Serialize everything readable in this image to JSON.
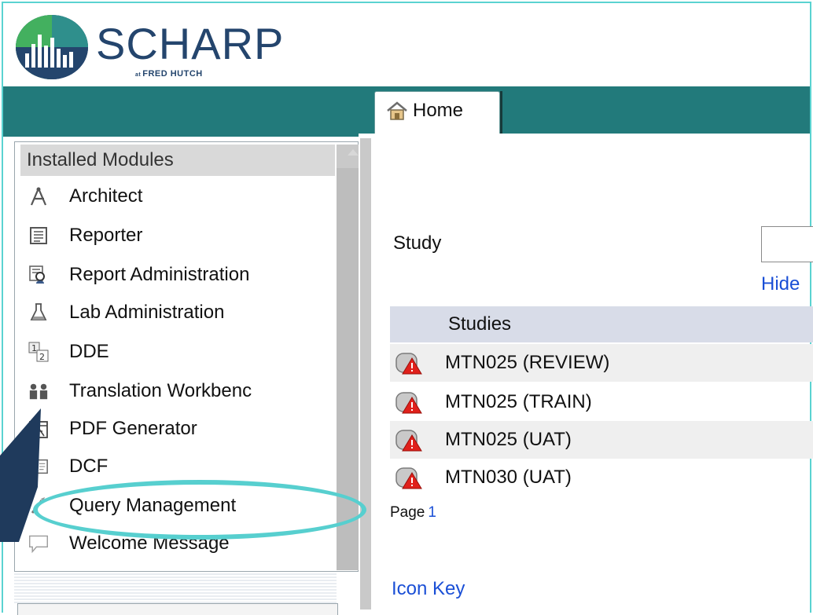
{
  "brand": {
    "name": "SCHARP",
    "sub_prefix": "at",
    "sub": "FRED HUTCH",
    "accent_color": "#227a7b",
    "highlight_color": "#57cfcf",
    "text_color": "#24456d"
  },
  "tabs": [
    {
      "label": "Home",
      "icon": "home-icon"
    }
  ],
  "sidebar": {
    "header": "Installed Modules",
    "items": [
      {
        "label": "Architect",
        "icon": "compass-icon"
      },
      {
        "label": "Reporter",
        "icon": "report-icon"
      },
      {
        "label": "Report Administration",
        "icon": "report-admin-icon"
      },
      {
        "label": "Lab Administration",
        "icon": "flask-icon"
      },
      {
        "label": "DDE",
        "icon": "dde-icon"
      },
      {
        "label": "Translation Workbenc",
        "icon": "translation-icon"
      },
      {
        "label": "PDF Generator",
        "icon": "pdf-icon"
      },
      {
        "label": "DCF",
        "icon": "dcf-icon"
      },
      {
        "label": "Query Management",
        "icon": "query-icon",
        "highlighted": true
      },
      {
        "label": "Welcome Message",
        "icon": "speech-bubble-icon"
      }
    ]
  },
  "main": {
    "study_label": "Study",
    "hide_link": "Hide",
    "studies_header": "Studies",
    "studies": [
      {
        "name": "MTN025 (REVIEW)",
        "icon": "study-warning-icon"
      },
      {
        "name": "MTN025 (TRAIN)",
        "icon": "study-warning-icon"
      },
      {
        "name": "MTN025 (UAT)",
        "icon": "study-warning-icon"
      },
      {
        "name": "MTN030 (UAT)",
        "icon": "study-warning-icon"
      }
    ],
    "page_label": "Page",
    "page_number": "1",
    "icon_key": "Icon Key"
  }
}
